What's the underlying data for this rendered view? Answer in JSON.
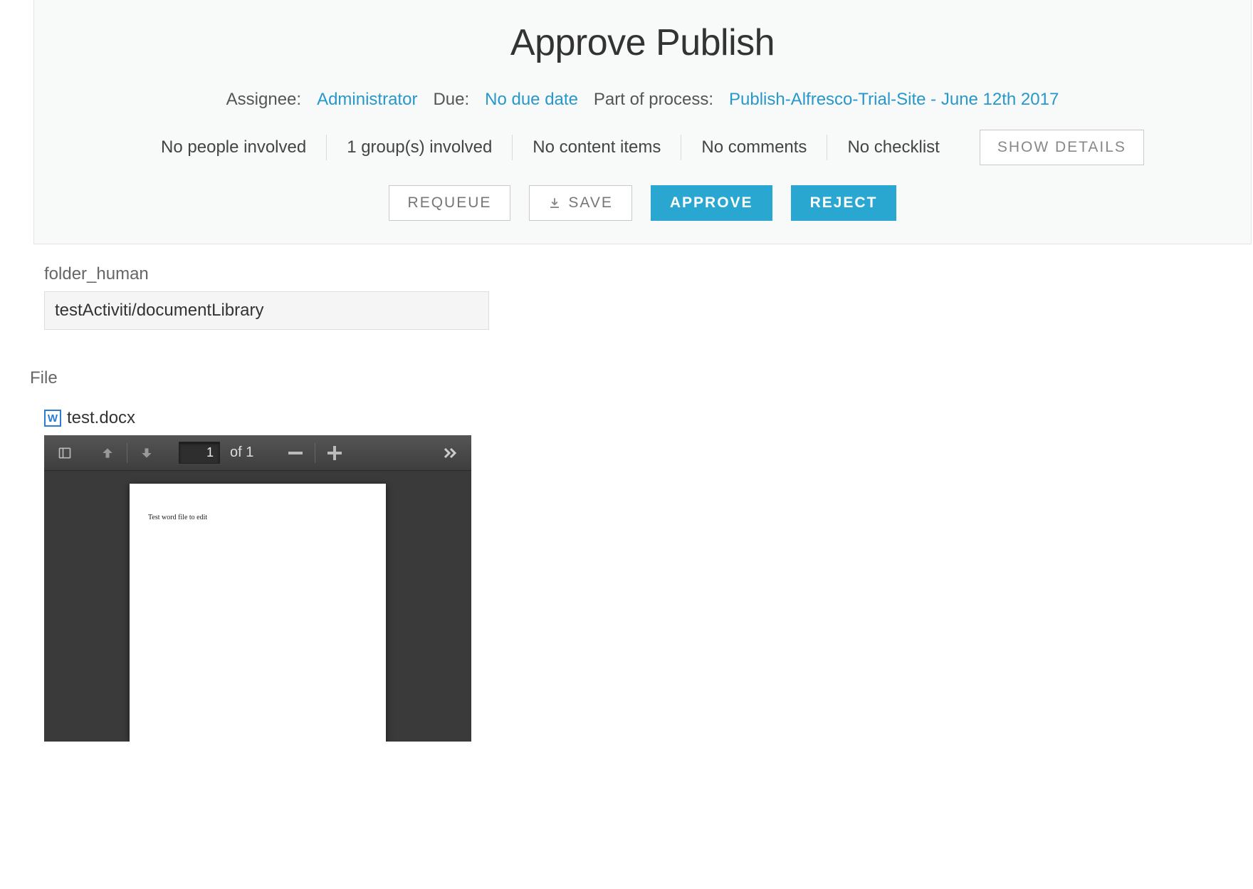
{
  "title": "Approve Publish",
  "meta": {
    "assignee_label": "Assignee:",
    "assignee_value": "Administrator",
    "due_label": "Due:",
    "due_value": "No due date",
    "process_label": "Part of process:",
    "process_value": "Publish-Alfresco-Trial-Site - June 12th 2017"
  },
  "info": {
    "people": "No people involved",
    "groups": "1 group(s) involved",
    "content": "No content items",
    "comments": "No comments",
    "checklist": "No checklist",
    "show_details": "SHOW DETAILS"
  },
  "actions": {
    "requeue": "REQUEUE",
    "save": "SAVE",
    "approve": "APPROVE",
    "reject": "REJECT"
  },
  "form": {
    "folder_label": "folder_human",
    "folder_value": "testActiviti/documentLibrary",
    "file_label": "File",
    "file_name": "test.docx"
  },
  "viewer": {
    "current_page": "1",
    "total_pages_text": "of 1",
    "document_text": "Test word file to edit"
  }
}
